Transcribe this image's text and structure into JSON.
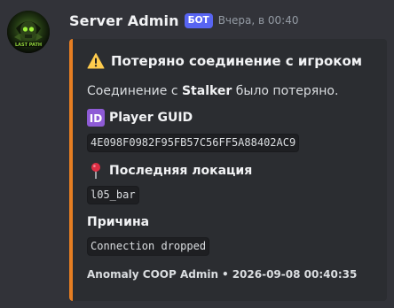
{
  "message": {
    "author": "Server Admin",
    "bot_tag": "БОТ",
    "timestamp": "Вчера, в 00:40",
    "avatar_text": "LAST PATH"
  },
  "embed": {
    "accent_color": "#e67e22",
    "title_icon": "warning-icon",
    "title": "Потеряно соединение с игроком",
    "description_prefix": "Соединение с ",
    "description_player": "Stalker",
    "description_suffix": " было потеряно.",
    "fields": [
      {
        "icon": "id-badge-icon",
        "icon_text": "ID",
        "name": "Player GUID",
        "value": "4E098F0982F95FB57C56FF5A88402AC9"
      },
      {
        "icon": "location-pin-icon",
        "name": "Последняя локация",
        "value": "l05_bar"
      },
      {
        "icon": "",
        "name": "Причина",
        "value": "Connection dropped"
      }
    ],
    "footer": {
      "text": "Anomaly COOP Admin",
      "separator": "•",
      "timestamp": "2026-09-08 00:40:35"
    }
  }
}
